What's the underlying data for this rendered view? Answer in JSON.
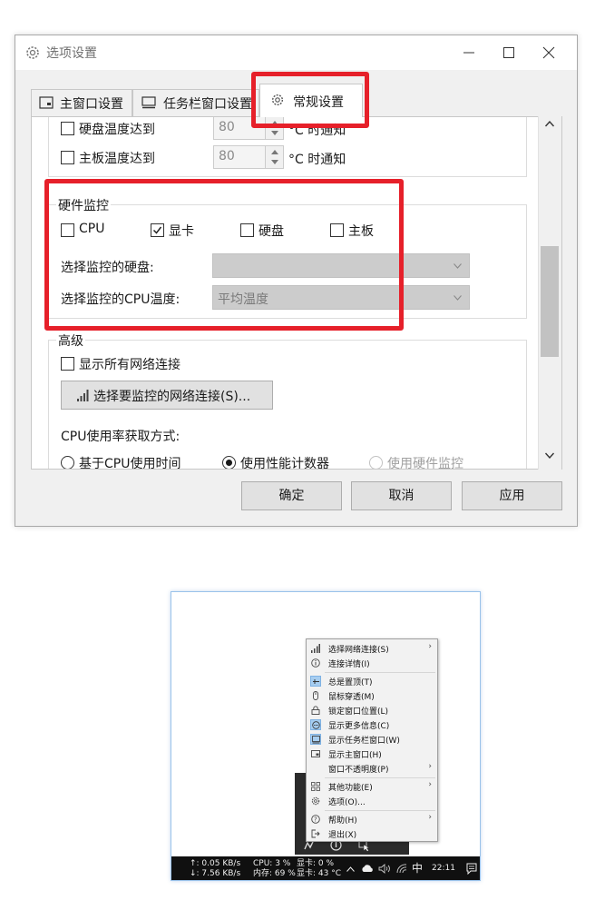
{
  "dialog": {
    "title": "选项设置",
    "tabs": [
      {
        "label": "主窗口设置",
        "active": false
      },
      {
        "label": "任务栏窗口设置",
        "active": false
      },
      {
        "label": "常规设置",
        "active": true
      }
    ],
    "temp_rows": [
      {
        "label": "硬盘温度达到",
        "value": "80",
        "suffix": "°C 时通知",
        "checked": false
      },
      {
        "label": "主板温度达到",
        "value": "80",
        "suffix": "°C 时通知",
        "checked": false
      }
    ],
    "hardware": {
      "title": "硬件监控",
      "checkboxes": [
        {
          "label": "CPU",
          "checked": false
        },
        {
          "label": "显卡",
          "checked": true
        },
        {
          "label": "硬盘",
          "checked": false
        },
        {
          "label": "主板",
          "checked": false
        }
      ],
      "disk_label": "选择监控的硬盘:",
      "disk_value": "",
      "cputemp_label": "选择监控的CPU温度:",
      "cputemp_value": "平均温度"
    },
    "advanced": {
      "title": "高级",
      "show_all_label": "显示所有网络连接",
      "select_net_button": "选择要监控的网络连接(S)...",
      "cpu_method_label": "CPU使用率获取方式:",
      "radios": [
        {
          "label": "基于CPU使用时间",
          "checked": false,
          "enabled": true
        },
        {
          "label": "使用性能计数器",
          "checked": true,
          "enabled": true
        },
        {
          "label": "使用硬件监控",
          "checked": false,
          "enabled": false
        }
      ]
    },
    "buttons": {
      "ok": "确定",
      "cancel": "取消",
      "apply": "应用"
    },
    "colors": {
      "highlight": "#e6202a",
      "window_bg": "#f0f0f0"
    }
  },
  "tray": {
    "menu": [
      {
        "label": "选择网络连接(S)",
        "icon": "signal-icon",
        "submenu": true,
        "selected": false
      },
      {
        "label": "连接详情(I)",
        "icon": "info-icon",
        "submenu": false,
        "selected": false
      },
      {
        "label": "总是置顶(T)",
        "icon": "pin-icon",
        "submenu": false,
        "selected": true
      },
      {
        "label": "鼠标穿透(M)",
        "icon": "mouse-icon",
        "submenu": false,
        "selected": false
      },
      {
        "label": "锁定窗口位置(L)",
        "icon": "lock-icon",
        "submenu": false,
        "selected": false
      },
      {
        "label": "显示更多信息(C)",
        "icon": "more-icon",
        "submenu": false,
        "selected": true
      },
      {
        "label": "显示任务栏窗口(W)",
        "icon": "taskbar-icon",
        "submenu": false,
        "selected": true
      },
      {
        "label": "显示主窗口(H)",
        "icon": "window-icon",
        "submenu": false,
        "selected": false
      },
      {
        "label": "窗口不透明度(P)",
        "icon": "",
        "submenu": true,
        "selected": false
      },
      {
        "label": "其他功能(E)",
        "icon": "grid-icon",
        "submenu": true,
        "selected": false
      },
      {
        "label": "选项(O)...",
        "icon": "gear-icon",
        "submenu": false,
        "selected": false
      },
      {
        "label": "帮助(H)",
        "icon": "help-icon",
        "submenu": true,
        "selected": false
      },
      {
        "label": "退出(X)",
        "icon": "exit-icon",
        "submenu": false,
        "selected": false
      }
    ],
    "taskbar": {
      "up": "↑: 0.05 KB/s",
      "down": "↓: 7.56 KB/s",
      "cpu": "CPU: 3 %",
      "gpu": "显卡: 0 %",
      "mem": "内存: 69 %",
      "gpu_temp": "显卡: 43 °C",
      "ime": "中",
      "clock": "22:11"
    }
  }
}
